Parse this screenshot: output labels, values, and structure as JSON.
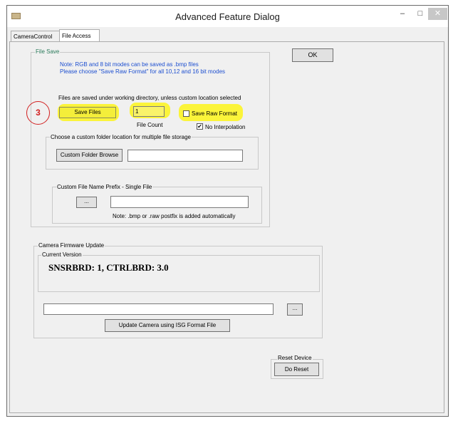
{
  "window": {
    "title": "Advanced Feature Dialog",
    "minimize_glyph": "–",
    "maximize_glyph": "□",
    "close_glyph": "✕"
  },
  "tabs": [
    {
      "label": "CameraControl"
    },
    {
      "label": "File Access"
    }
  ],
  "ok_label": "OK",
  "file_save": {
    "label": "File Save",
    "note_line1": "Note:  RGB and 8 bit modes can be saved as .bmp files",
    "note_line2": "Please choose \"Save Raw Format\" for all 10,12 and 16 bit modes",
    "location_text": "Files are saved under working directory, unless custom location selected",
    "step_marker": "3",
    "save_files_label": "Save Files",
    "file_count_value": "1",
    "file_count_label": "File Count",
    "save_raw_label": "Save Raw Format",
    "save_raw_checked": false,
    "no_interp_label": "No Interpolation",
    "no_interp_checked": true,
    "no_interp_mark": "✔",
    "custom_folder": {
      "label": "Choose a custom folder location for multiple file storage",
      "browse_label": "Custom Folder Browse",
      "path_value": ""
    },
    "prefix": {
      "label": "Custom File Name Prefix - Single File",
      "dots_label": "...",
      "value": "",
      "note": "Note: .bmp or .raw postfix is added automatically"
    }
  },
  "firmware": {
    "label": "Camera Firmware Update",
    "current_version_label": "Current Version",
    "version_text": "SNSRBRD: 1, CTRLBRD: 3.0",
    "file_path_value": "",
    "dots_label": "...",
    "update_label": "Update Camera using ISG Format File"
  },
  "reset": {
    "label": "Reset Device",
    "button_label": "Do Reset"
  },
  "colors": {
    "note_text": "#1d4fd0",
    "group_label": "#2a7a5a",
    "highlight": "#fbf43a",
    "step_circle": "#d22020"
  }
}
